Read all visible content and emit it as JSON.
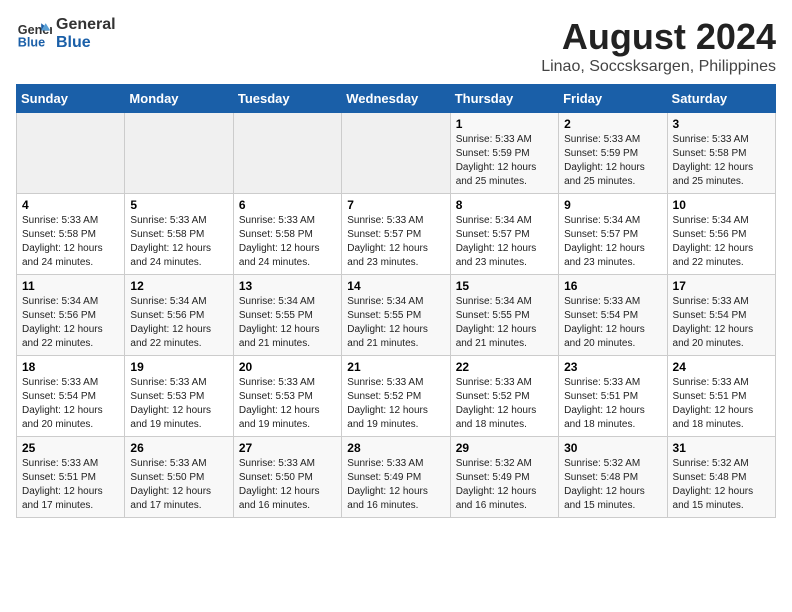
{
  "logo": {
    "line1": "General",
    "line2": "Blue"
  },
  "title": "August 2024",
  "subtitle": "Linao, Soccsksargen, Philippines",
  "days_header": [
    "Sunday",
    "Monday",
    "Tuesday",
    "Wednesday",
    "Thursday",
    "Friday",
    "Saturday"
  ],
  "weeks": [
    [
      {
        "day": "",
        "info": ""
      },
      {
        "day": "",
        "info": ""
      },
      {
        "day": "",
        "info": ""
      },
      {
        "day": "",
        "info": ""
      },
      {
        "day": "1",
        "info": "Sunrise: 5:33 AM\nSunset: 5:59 PM\nDaylight: 12 hours\nand 25 minutes."
      },
      {
        "day": "2",
        "info": "Sunrise: 5:33 AM\nSunset: 5:59 PM\nDaylight: 12 hours\nand 25 minutes."
      },
      {
        "day": "3",
        "info": "Sunrise: 5:33 AM\nSunset: 5:58 PM\nDaylight: 12 hours\nand 25 minutes."
      }
    ],
    [
      {
        "day": "4",
        "info": "Sunrise: 5:33 AM\nSunset: 5:58 PM\nDaylight: 12 hours\nand 24 minutes."
      },
      {
        "day": "5",
        "info": "Sunrise: 5:33 AM\nSunset: 5:58 PM\nDaylight: 12 hours\nand 24 minutes."
      },
      {
        "day": "6",
        "info": "Sunrise: 5:33 AM\nSunset: 5:58 PM\nDaylight: 12 hours\nand 24 minutes."
      },
      {
        "day": "7",
        "info": "Sunrise: 5:33 AM\nSunset: 5:57 PM\nDaylight: 12 hours\nand 23 minutes."
      },
      {
        "day": "8",
        "info": "Sunrise: 5:34 AM\nSunset: 5:57 PM\nDaylight: 12 hours\nand 23 minutes."
      },
      {
        "day": "9",
        "info": "Sunrise: 5:34 AM\nSunset: 5:57 PM\nDaylight: 12 hours\nand 23 minutes."
      },
      {
        "day": "10",
        "info": "Sunrise: 5:34 AM\nSunset: 5:56 PM\nDaylight: 12 hours\nand 22 minutes."
      }
    ],
    [
      {
        "day": "11",
        "info": "Sunrise: 5:34 AM\nSunset: 5:56 PM\nDaylight: 12 hours\nand 22 minutes."
      },
      {
        "day": "12",
        "info": "Sunrise: 5:34 AM\nSunset: 5:56 PM\nDaylight: 12 hours\nand 22 minutes."
      },
      {
        "day": "13",
        "info": "Sunrise: 5:34 AM\nSunset: 5:55 PM\nDaylight: 12 hours\nand 21 minutes."
      },
      {
        "day": "14",
        "info": "Sunrise: 5:34 AM\nSunset: 5:55 PM\nDaylight: 12 hours\nand 21 minutes."
      },
      {
        "day": "15",
        "info": "Sunrise: 5:34 AM\nSunset: 5:55 PM\nDaylight: 12 hours\nand 21 minutes."
      },
      {
        "day": "16",
        "info": "Sunrise: 5:33 AM\nSunset: 5:54 PM\nDaylight: 12 hours\nand 20 minutes."
      },
      {
        "day": "17",
        "info": "Sunrise: 5:33 AM\nSunset: 5:54 PM\nDaylight: 12 hours\nand 20 minutes."
      }
    ],
    [
      {
        "day": "18",
        "info": "Sunrise: 5:33 AM\nSunset: 5:54 PM\nDaylight: 12 hours\nand 20 minutes."
      },
      {
        "day": "19",
        "info": "Sunrise: 5:33 AM\nSunset: 5:53 PM\nDaylight: 12 hours\nand 19 minutes."
      },
      {
        "day": "20",
        "info": "Sunrise: 5:33 AM\nSunset: 5:53 PM\nDaylight: 12 hours\nand 19 minutes."
      },
      {
        "day": "21",
        "info": "Sunrise: 5:33 AM\nSunset: 5:52 PM\nDaylight: 12 hours\nand 19 minutes."
      },
      {
        "day": "22",
        "info": "Sunrise: 5:33 AM\nSunset: 5:52 PM\nDaylight: 12 hours\nand 18 minutes."
      },
      {
        "day": "23",
        "info": "Sunrise: 5:33 AM\nSunset: 5:51 PM\nDaylight: 12 hours\nand 18 minutes."
      },
      {
        "day": "24",
        "info": "Sunrise: 5:33 AM\nSunset: 5:51 PM\nDaylight: 12 hours\nand 18 minutes."
      }
    ],
    [
      {
        "day": "25",
        "info": "Sunrise: 5:33 AM\nSunset: 5:51 PM\nDaylight: 12 hours\nand 17 minutes."
      },
      {
        "day": "26",
        "info": "Sunrise: 5:33 AM\nSunset: 5:50 PM\nDaylight: 12 hours\nand 17 minutes."
      },
      {
        "day": "27",
        "info": "Sunrise: 5:33 AM\nSunset: 5:50 PM\nDaylight: 12 hours\nand 16 minutes."
      },
      {
        "day": "28",
        "info": "Sunrise: 5:33 AM\nSunset: 5:49 PM\nDaylight: 12 hours\nand 16 minutes."
      },
      {
        "day": "29",
        "info": "Sunrise: 5:32 AM\nSunset: 5:49 PM\nDaylight: 12 hours\nand 16 minutes."
      },
      {
        "day": "30",
        "info": "Sunrise: 5:32 AM\nSunset: 5:48 PM\nDaylight: 12 hours\nand 15 minutes."
      },
      {
        "day": "31",
        "info": "Sunrise: 5:32 AM\nSunset: 5:48 PM\nDaylight: 12 hours\nand 15 minutes."
      }
    ]
  ]
}
